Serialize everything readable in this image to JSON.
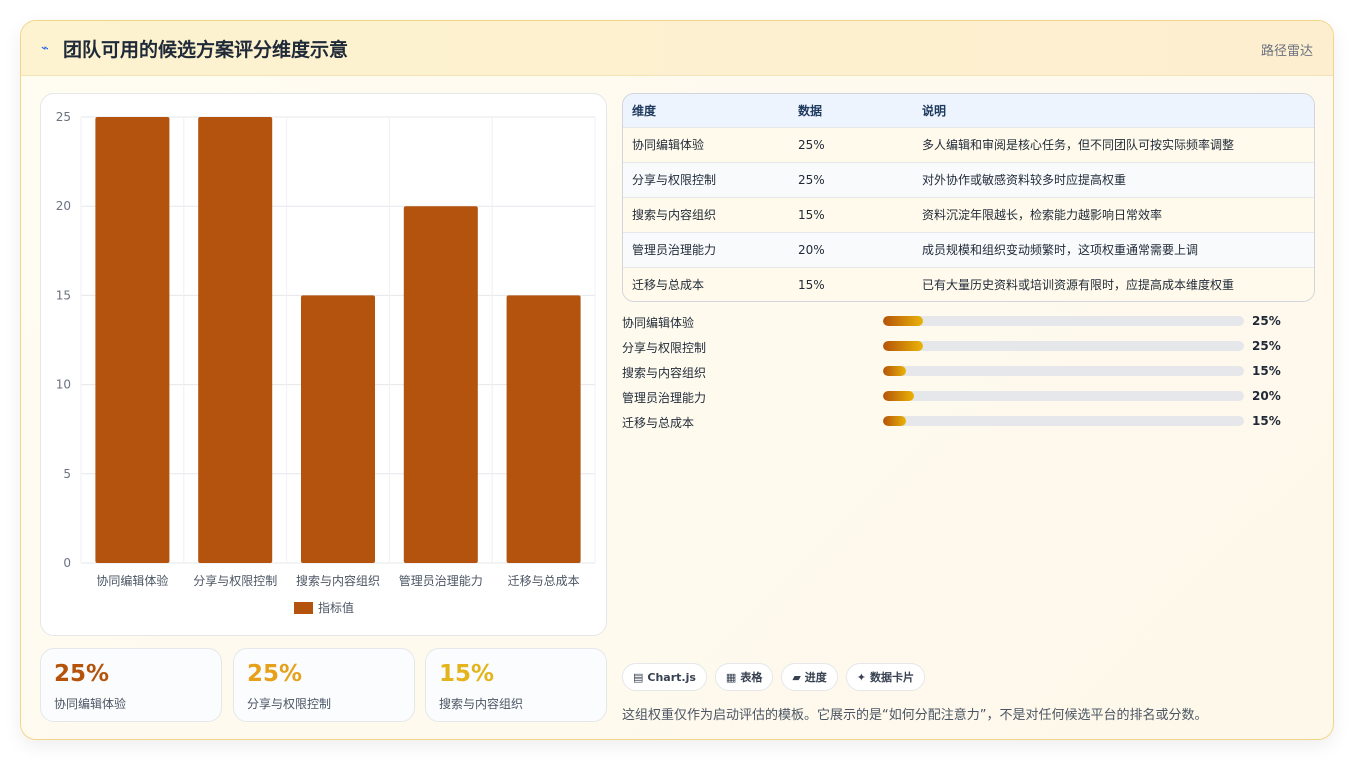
{
  "header": {
    "icon": "trend-icon",
    "title": "团队可用的候选方案评分维度示意",
    "badge": "路径雷达"
  },
  "chart_data": {
    "type": "bar",
    "categories": [
      "协同编辑体验",
      "分享与权限控制",
      "搜索与内容组织",
      "管理员治理能力",
      "迁移与总成本"
    ],
    "series": [
      {
        "name": "指标值",
        "values": [
          25,
          25,
          15,
          20,
          15
        ]
      }
    ],
    "yticks": [
      "0",
      "5",
      "10",
      "15",
      "20",
      "25"
    ],
    "ylim": [
      0,
      25
    ],
    "legend_position": "bottom",
    "color": "#b4530d",
    "grid": true
  },
  "stats": [
    {
      "value": "25%",
      "label": "协同编辑体验",
      "color": "#b45309"
    },
    {
      "value": "25%",
      "label": "分享与权限控制",
      "color": "#e6a01a"
    },
    {
      "value": "15%",
      "label": "搜索与内容组织",
      "color": "#e3b41c"
    }
  ],
  "table": {
    "headers": [
      "维度",
      "数据",
      "说明"
    ],
    "rows": [
      [
        "协同编辑体验",
        "25%",
        "多人编辑和审阅是核心任务，但不同团队可按实际频率调整"
      ],
      [
        "分享与权限控制",
        "25%",
        "对外协作或敏感资料较多时应提高权重"
      ],
      [
        "搜索与内容组织",
        "15%",
        "资料沉淀年限越长，检索能力越影响日常效率"
      ],
      [
        "管理员治理能力",
        "20%",
        "成员规模和组织变动频繁时，这项权重通常需要上调"
      ],
      [
        "迁移与总成本",
        "15%",
        "已有大量历史资料或培训资源有限时，应提高成本维度权重"
      ]
    ]
  },
  "progress": [
    {
      "label": "协同编辑体验",
      "value": "25%",
      "fraction": 0.11
    },
    {
      "label": "分享与权限控制",
      "value": "25%",
      "fraction": 0.11
    },
    {
      "label": "搜索与内容组织",
      "value": "15%",
      "fraction": 0.065
    },
    {
      "label": "管理员治理能力",
      "value": "20%",
      "fraction": 0.087
    },
    {
      "label": "迁移与总成本",
      "value": "15%",
      "fraction": 0.065
    }
  ],
  "chips": [
    {
      "icon": "▤",
      "label": "Chart.js"
    },
    {
      "icon": "▦",
      "label": "表格"
    },
    {
      "icon": "▰",
      "label": "进度"
    },
    {
      "icon": "✦",
      "label": "数据卡片"
    }
  ],
  "footnote": "这组权重仅作为启动评估的模板。它展示的是“如何分配注意力”，不是对任何候选平台的排名或分数。"
}
